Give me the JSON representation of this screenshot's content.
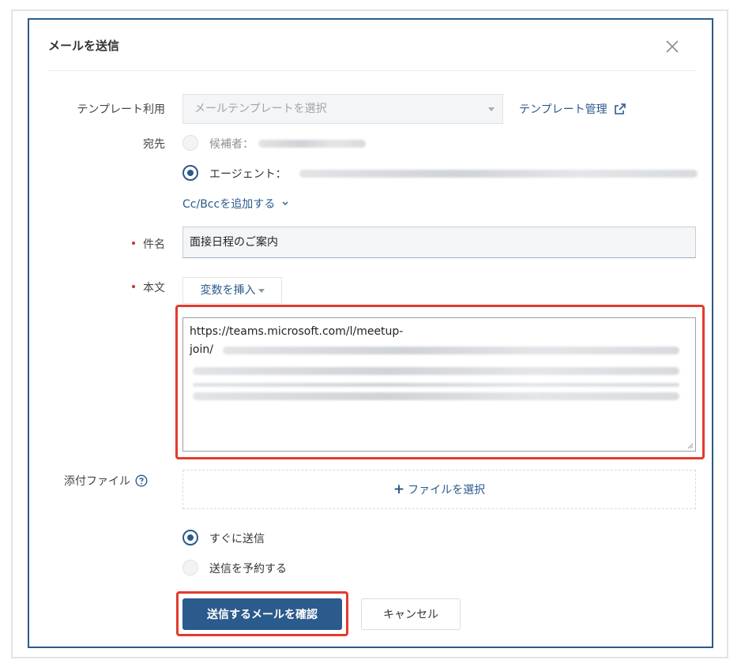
{
  "dialog": {
    "title": "メールを送信"
  },
  "template": {
    "label": "テンプレート利用",
    "select_placeholder": "メールテンプレートを選択",
    "manage_link": "テンプレート管理"
  },
  "recipient": {
    "label": "宛先",
    "candidate_label": "候補者：",
    "agent_label": "エージェント：",
    "cc_link": "Cc/Bccを追加する"
  },
  "subject": {
    "label": "件名",
    "value": "面接日程のご案内"
  },
  "body": {
    "label": "本文",
    "insert_variable": "変数を挿入",
    "text_line1": "https://teams.microsoft.com/l/meetup-",
    "text_line2": "join/"
  },
  "attachment": {
    "label": "添付ファイル",
    "select_file": "ファイルを選択"
  },
  "send_timing": {
    "immediate": "すぐに送信",
    "scheduled": "送信を予約する"
  },
  "actions": {
    "confirm": "送信するメールを確認",
    "cancel": "キャンセル"
  },
  "colors": {
    "primary": "#2b5a8c",
    "highlight": "#e23b2e",
    "required": "#c0392b"
  }
}
